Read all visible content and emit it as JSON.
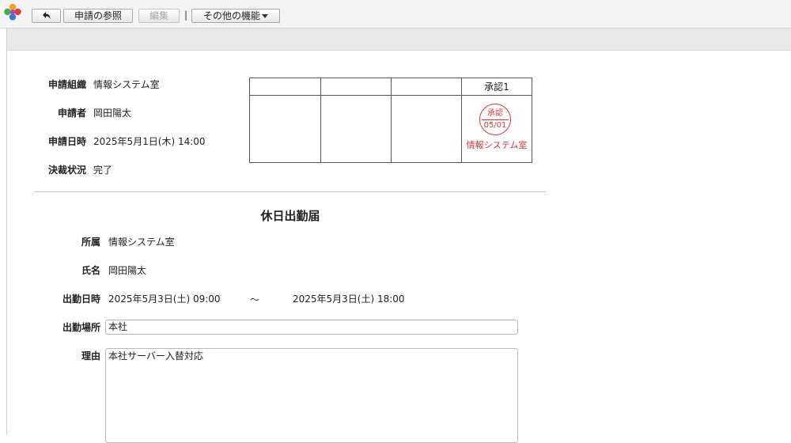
{
  "toolbar": {
    "back_icon": "back-arrow-icon",
    "reference_label": "申請の参照",
    "edit_label": "編集",
    "separator": "|",
    "more_label": "その他の機能"
  },
  "header": {
    "org_label": "申請組織",
    "org_value": "情報システム室",
    "applicant_label": "申請者",
    "applicant_value": "岡田陽太",
    "date_label": "申請日時",
    "date_value": "2025年5月1日(木) 14:00",
    "status_label": "決裁状況",
    "status_value": "完了"
  },
  "approval": {
    "columns": [
      "",
      "",
      "",
      "承認1"
    ],
    "stamp": {
      "label": "承認",
      "date": "05/01",
      "org": "情報システム室",
      "color": "#d23a3a"
    }
  },
  "form": {
    "title": "休日出勤届",
    "dept_label": "所属",
    "dept_value": "情報システム室",
    "name_label": "氏名",
    "name_value": "岡田陽太",
    "work_label": "出勤日時",
    "work_start": "2025年5月3日(土) 09:00",
    "work_tilde": "～",
    "work_end": "2025年5月3日(土) 18:00",
    "place_label": "出勤場所",
    "place_value": "本社",
    "reason_label": "理由",
    "reason_value": "本社サーバー入替対応"
  }
}
